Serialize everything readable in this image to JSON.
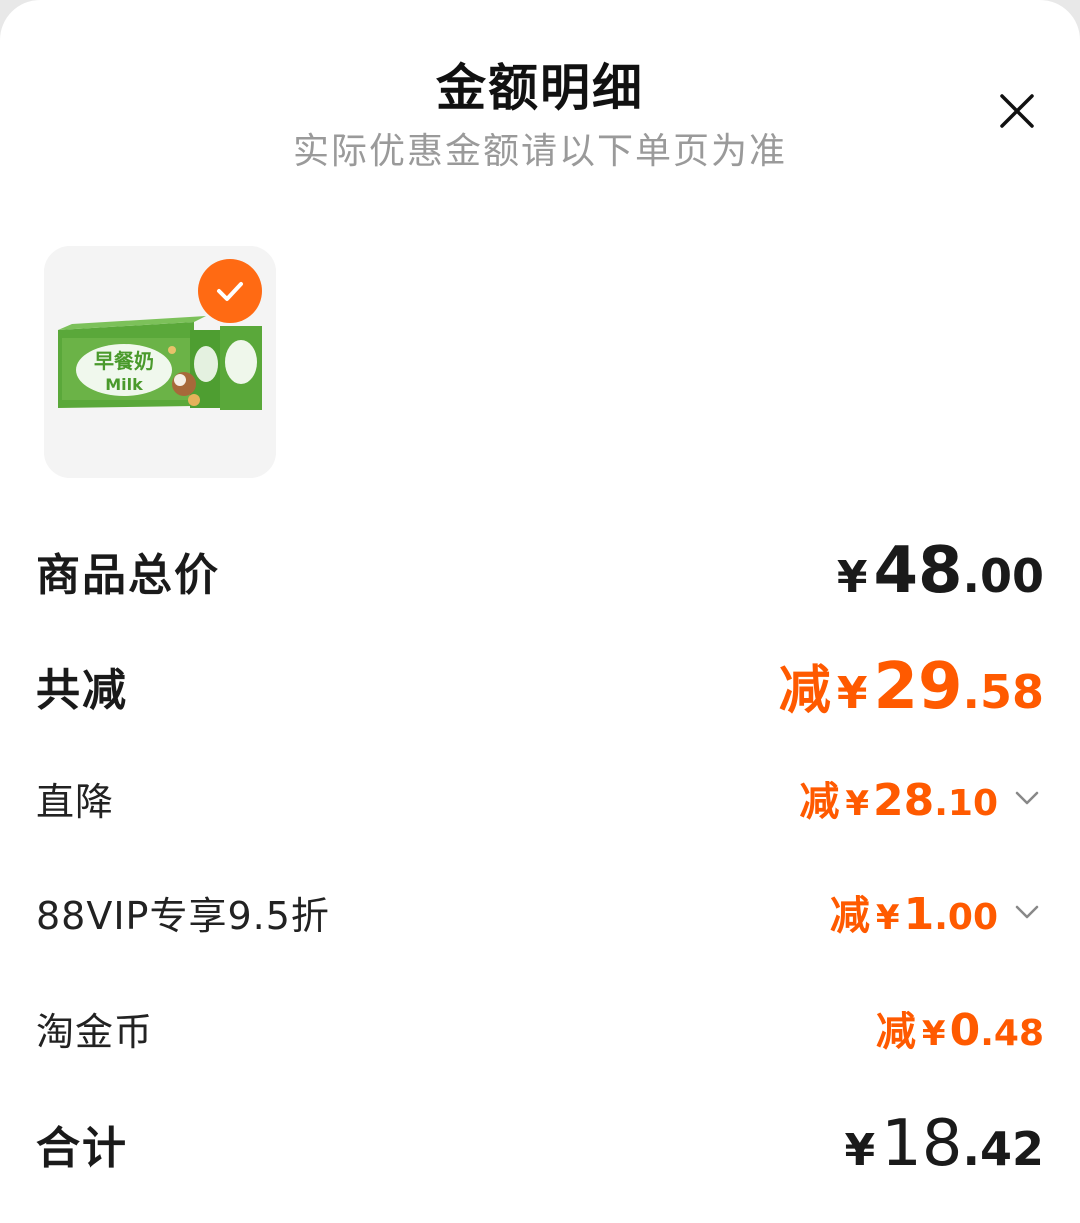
{
  "header": {
    "title": "金额明细",
    "subtitle": "实际优惠金额请以下单页为准"
  },
  "product": {
    "image_text_main": "早餐奶",
    "image_text_sub": "Milk",
    "selected": true
  },
  "rows": [
    {
      "label": "商品总价",
      "prefix": "",
      "yen": "¥",
      "int": "48",
      "dec": ".00"
    },
    {
      "label": "共减",
      "prefix": "减",
      "yen": "¥",
      "int": "29",
      "dec": ".58"
    },
    {
      "label": "直降",
      "prefix": "减",
      "yen": "¥",
      "int": "28",
      "dec": ".10"
    },
    {
      "label": "88VIP专享9.5折",
      "prefix": "减",
      "yen": "¥",
      "int": "1",
      "dec": ".00"
    },
    {
      "label": "淘金币",
      "prefix": "减",
      "yen": "¥",
      "int": "0",
      "dec": ".48"
    },
    {
      "label": "合计",
      "prefix": "",
      "yen": "¥",
      "int": "18",
      "dec": ".42"
    }
  ],
  "colors": {
    "accent": "#ff5a00",
    "check": "#ff6a13",
    "text": "#1a1a1a",
    "muted": "#9a9a9a"
  }
}
